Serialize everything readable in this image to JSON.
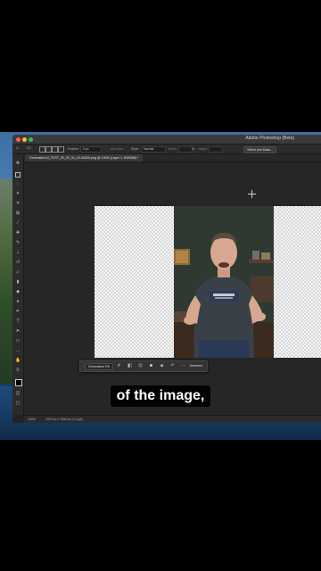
{
  "window": {
    "app_title": "Adobe Photoshop (Beta)",
    "traffic_lights": [
      "#ff5f57",
      "#febc2e",
      "#28c840"
    ]
  },
  "options_bar": {
    "feather_label": "Feather:",
    "feather_value": "0 px",
    "antialias_label": "Anti-alias",
    "style_label": "Style:",
    "style_value": "Normal",
    "width_label": "Width:",
    "height_label": "Height:",
    "select_subject_label": "Select and Mask..."
  },
  "document_tab": {
    "label": "Generative AI_TEST_00_00_51_03.00000.png @ 100% (Layer 1, RGB/8#) *"
  },
  "toolbar": {
    "icons": [
      "move-icon",
      "marquee-icon",
      "lasso-icon",
      "magic-wand-icon",
      "crop-icon",
      "frame-icon",
      "eyedropper-icon",
      "spot-heal-icon",
      "brush-icon",
      "stamp-icon",
      "history-brush-icon",
      "eraser-icon",
      "gradient-icon",
      "blur-icon",
      "dodge-icon",
      "pen-icon",
      "type-icon",
      "path-select-icon",
      "rectangle-icon",
      "hand-icon",
      "zoom-icon",
      "more-tools-icon"
    ]
  },
  "contextual_taskbar": {
    "generative_fill_label": "Generative Fill",
    "deselect_label": "Deselect"
  },
  "status_bar": {
    "zoom": "100%",
    "doc_size": "1920 px x 1080 px (72 ppi)"
  },
  "caption": {
    "text": "of the image,"
  }
}
